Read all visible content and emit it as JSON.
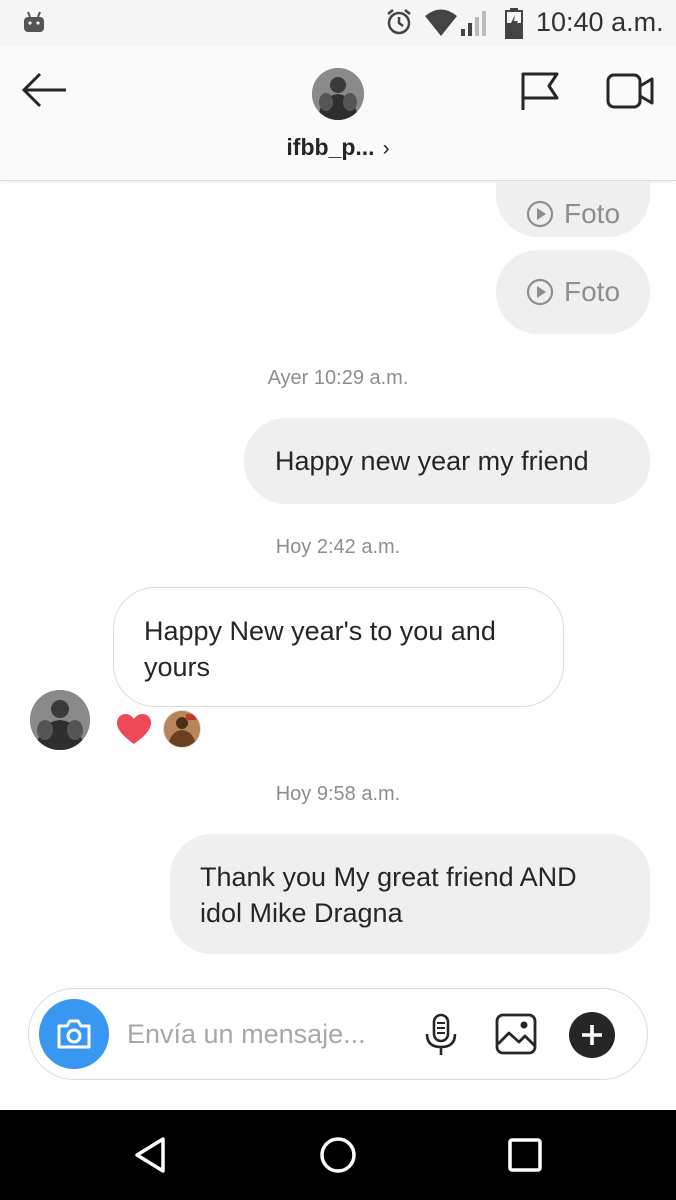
{
  "status_bar": {
    "time": "10:40 a.m."
  },
  "header": {
    "username": "ifbb_p...",
    "chevron": "›"
  },
  "messages": {
    "foto1": "Foto",
    "foto2": "Foto",
    "ts1": "Ayer 10:29 a.m.",
    "msg1": "Happy new year my friend",
    "ts2": "Hoy 2:42 a.m.",
    "msg2": "Happy New year's to you and yours",
    "ts3": "Hoy 9:58 a.m.",
    "msg3": "Thank you My great friend AND idol Mike Dragna"
  },
  "composer": {
    "placeholder": "Envía un mensaje..."
  },
  "colors": {
    "accent": "#3897f0",
    "heart": "#ed4956",
    "sent_bubble": "#efefef"
  },
  "icons": [
    "android-icon",
    "alarm-icon",
    "wifi-icon",
    "signal-icon",
    "battery-icon",
    "back-arrow-icon",
    "flag-icon",
    "video-call-icon",
    "play-icon",
    "heart-icon",
    "camera-icon",
    "microphone-icon",
    "gallery-icon",
    "plus-icon",
    "nav-back-icon",
    "nav-home-icon",
    "nav-recent-icon"
  ]
}
